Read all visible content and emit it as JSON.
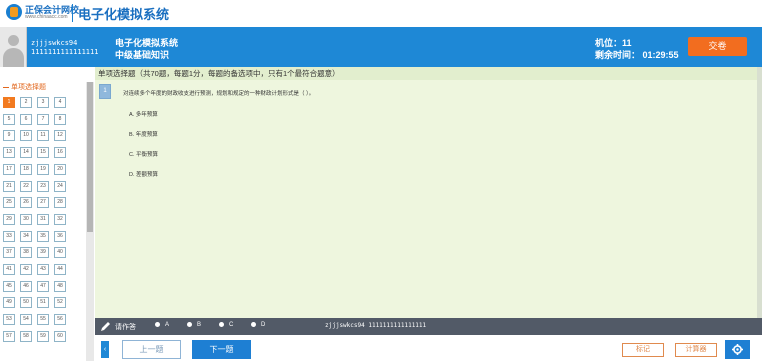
{
  "header": {
    "logo_brand": "正保会计网校",
    "logo_url": "www.chinaacc.com",
    "system_title": "电子化模拟系统"
  },
  "info_bar": {
    "username": "zjjjswkcs94",
    "user_id": "1111111111111111",
    "exam_name": "电子化模拟系统",
    "exam_subject": "中级基础知识",
    "seat_label": "机位：11",
    "time_label": "剩余时间：  01:29:55",
    "submit_label": "交卷"
  },
  "sidebar": {
    "section_title": "单项选择题",
    "numbers": [
      "1",
      "2",
      "3",
      "4",
      "5",
      "6",
      "7",
      "8",
      "9",
      "10",
      "11",
      "12",
      "13",
      "14",
      "15",
      "16",
      "17",
      "18",
      "19",
      "20",
      "21",
      "22",
      "23",
      "24",
      "25",
      "26",
      "27",
      "28",
      "29",
      "30",
      "31",
      "32",
      "33",
      "34",
      "35",
      "36",
      "37",
      "38",
      "39",
      "40",
      "41",
      "42",
      "43",
      "44",
      "45",
      "46",
      "47",
      "48",
      "49",
      "50",
      "51",
      "52",
      "53",
      "54",
      "55",
      "56",
      "57",
      "58",
      "59",
      "60"
    ],
    "active": "1"
  },
  "question": {
    "type_header": "单项选择题（共70题，每题1分，每题的备选项中，只有1个最符合题意）",
    "number": "1",
    "text": "对连续多个年度的财政收支进行预测，规划和规定的一种财政计划形式是（    ）。",
    "options": [
      "A. 多年预算",
      "B. 年度预算",
      "C. 平衡预算",
      "D. 差额预算"
    ]
  },
  "answer_bar": {
    "label": "请作答",
    "options": [
      "A",
      "B",
      "C",
      "D"
    ],
    "user": "zjjjswkcs94 1111111111111111"
  },
  "bottom": {
    "prev_label": "上一题",
    "next_label": "下一题",
    "mark_label": "标记",
    "calc_label": "计算器",
    "collapse_glyph": "‹"
  },
  "colors": {
    "brand_blue": "#1e88d6",
    "accent_orange": "#f26d1f",
    "answer_bar": "#525a67",
    "question_bg": "#eef6de"
  }
}
